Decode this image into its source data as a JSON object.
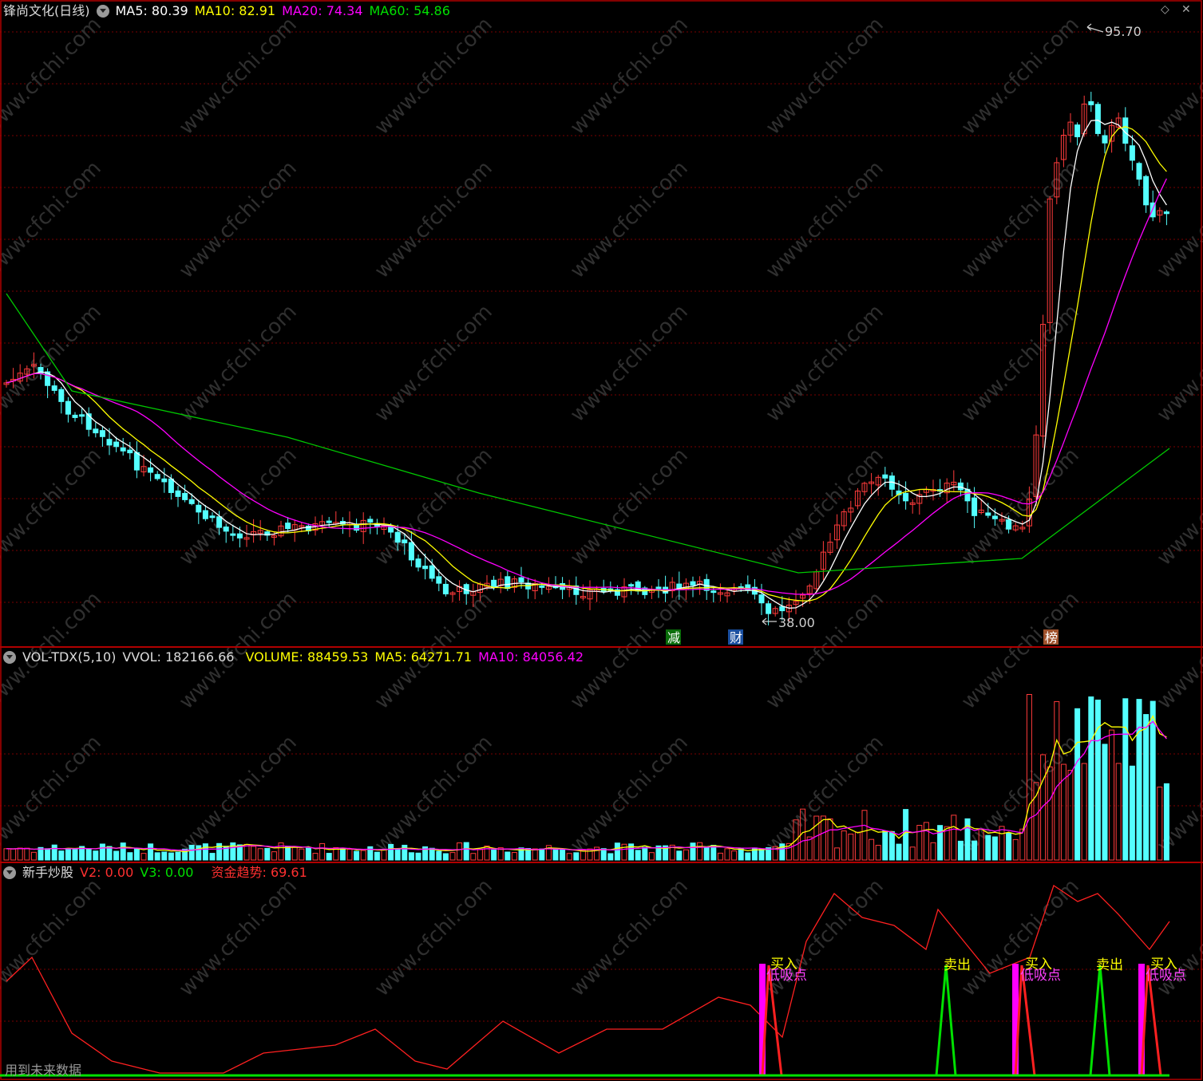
{
  "header_main": {
    "title": "锋尚文化(日线)",
    "ma5": "MA5: 80.39",
    "ma10": "MA10: 82.91",
    "ma20": "MA20: 74.34",
    "ma60": "MA60: 54.86"
  },
  "header_vol": {
    "name": "VOL-TDX(5,10)",
    "vvol": "VVOL: 182166.66",
    "volume": "VOLUME: 88459.53",
    "ma5": "MA5: 64271.71",
    "ma10": "MA10: 84056.42"
  },
  "header_ind": {
    "name": "新手炒股",
    "v2": "V2: 0.00",
    "v3": "V3: 0.00",
    "trend": "资金趋势: 69.61"
  },
  "annotations": {
    "high": "95.70",
    "low": "38.00",
    "mark_jian": "减",
    "mark_cai": "财",
    "mark_bang": "榜",
    "buy": "买入",
    "low_absorb": "低吸点",
    "sell": "卖出",
    "bottom_note": "用到未来数据"
  },
  "watermark": "www.cfchi.com",
  "top_right_icons": [
    "diamond-icon",
    "close-icon"
  ],
  "colors": {
    "up": "#ff3b3b",
    "down": "#54ffff",
    "ma5": "#ffffff",
    "ma10": "#ffff00",
    "ma20": "#ff00ff",
    "ma60": "#00c800",
    "grid": "#7a0000",
    "border": "#b00000"
  }
}
